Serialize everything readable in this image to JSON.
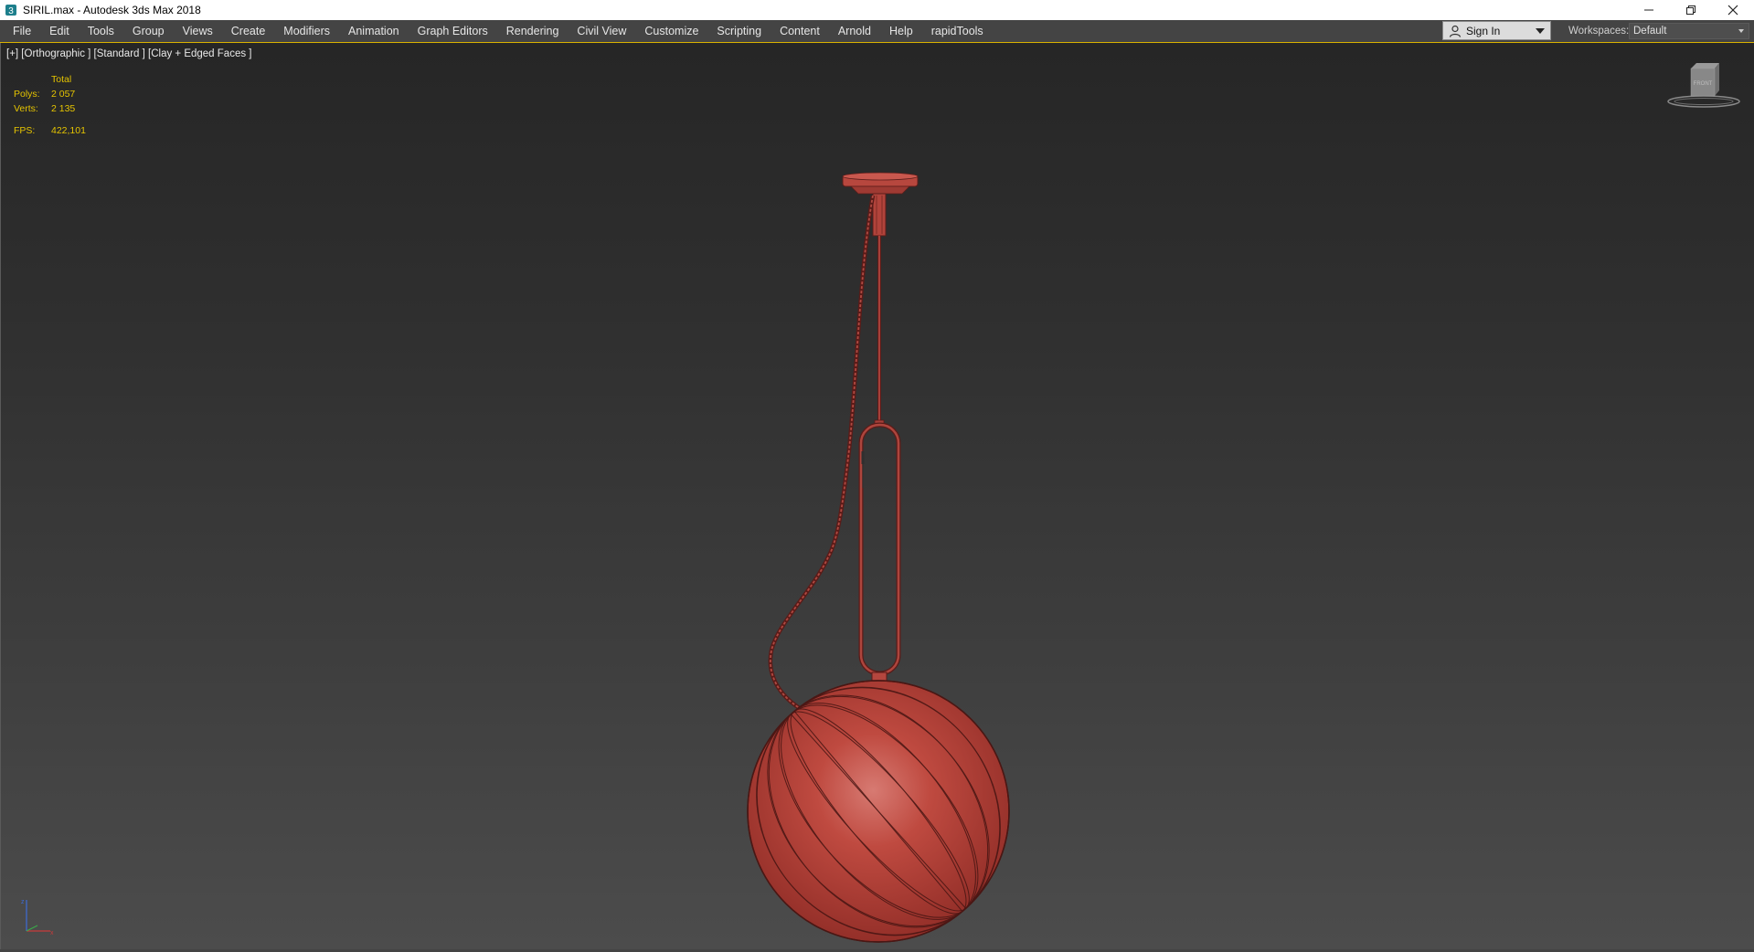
{
  "window": {
    "title": "SIRIL.max - Autodesk 3ds Max 2018",
    "controls": [
      "minimize-icon",
      "restore-icon",
      "close-icon"
    ]
  },
  "menu": {
    "items": [
      "File",
      "Edit",
      "Tools",
      "Group",
      "Views",
      "Create",
      "Modifiers",
      "Animation",
      "Graph Editors",
      "Rendering",
      "Civil View",
      "Customize",
      "Scripting",
      "Content",
      "Arnold",
      "Help",
      "rapidTools"
    ]
  },
  "account": {
    "sign_in_label": "Sign In",
    "workspaces_label": "Workspaces:",
    "workspace_value": "Default"
  },
  "viewport": {
    "label": "[+] [Orthographic ] [Standard ] [Clay + Edged Faces ]",
    "stats": {
      "header": "Total",
      "polys_label": "Polys:",
      "polys_value": "2 057",
      "verts_label": "Verts:",
      "verts_value": "2 135",
      "fps_label": "FPS:",
      "fps_value": "422,101"
    },
    "viewcube_face": "FRONT"
  },
  "colors": {
    "accent": "#d9b200",
    "stats_text": "#e5c400",
    "model_clay": "#b03a32"
  }
}
